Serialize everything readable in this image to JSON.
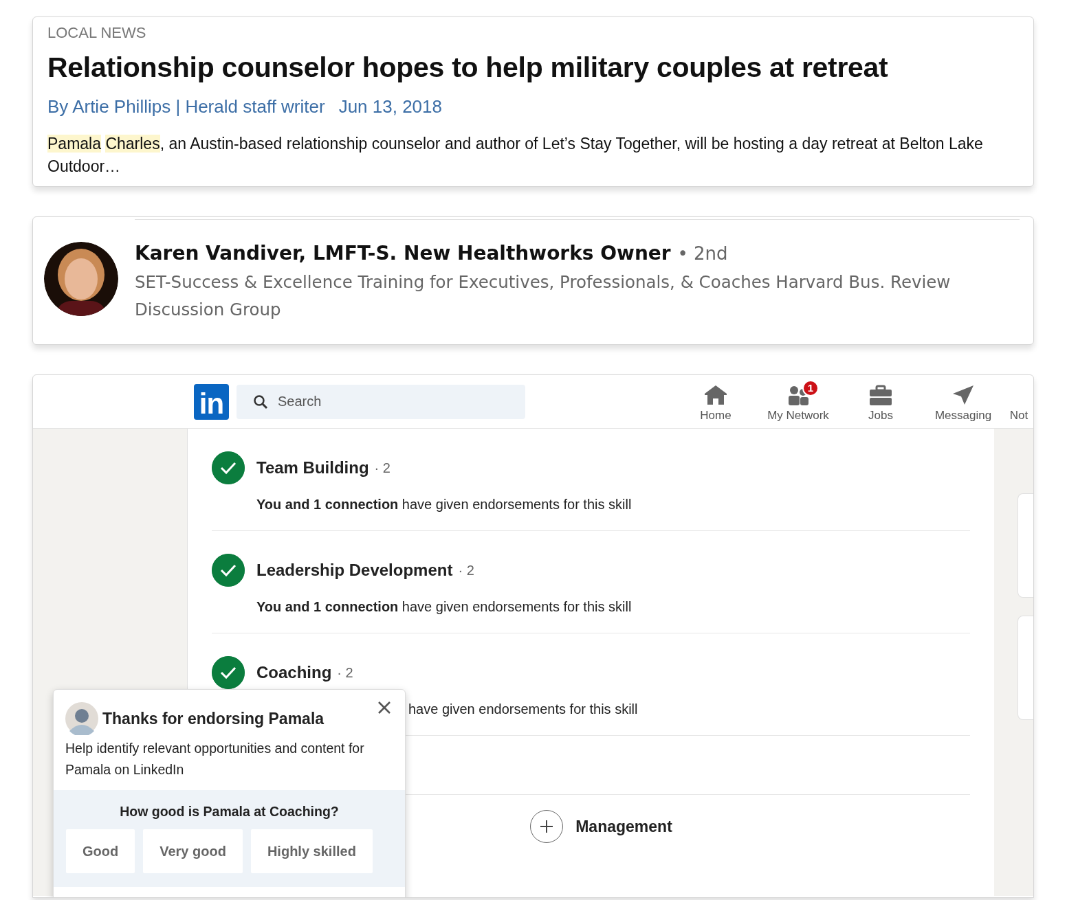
{
  "article": {
    "section": "LOCAL NEWS",
    "headline": "Relationship counselor hopes to help military couples at retreat",
    "byline": "By Artie Phillips | Herald staff writer",
    "date": "Jun 13, 2018",
    "excerpt": [
      {
        "text": "Pamala",
        "highlighted": true
      },
      {
        "text": "Charles",
        "highlighted": true
      },
      {
        "text": ", an Austin-based relationship counselor and author of Let’s Stay Together, will be hosting a day retreat at Belton Lake Outdoor…",
        "highlighted": false
      }
    ]
  },
  "profile": {
    "name": "Karen Vandiver, LMFT-S. New Healthworks Owner",
    "degree": "• 2nd",
    "headline": "SET-Success & Excellence Training for Executives, Professionals, & Coaches Harvard Bus. Review Discussion Group"
  },
  "linkedin": {
    "logo": "in",
    "search": {
      "placeholder": "Search"
    },
    "nav": [
      {
        "label": "Home"
      },
      {
        "label": "My Network",
        "badge": "1"
      },
      {
        "label": "Jobs"
      },
      {
        "label": "Messaging"
      },
      {
        "label": "Not"
      }
    ],
    "skills": [
      {
        "name": "Team Building",
        "count": "· 2",
        "endorsed": true,
        "kind": "full",
        "endorsement": "**You and 1 connection** have given endorsements for this skill"
      },
      {
        "name": "Leadership Development",
        "count": "· 2",
        "endorsed": true,
        "kind": "full",
        "endorsement": "**You and 1 connection** have given endorsements for this skill"
      },
      {
        "name": "Coaching",
        "count": "· 2",
        "endorsed": true,
        "kind": "covered",
        "endorsement": "have given endorsements for this skill"
      },
      {
        "name": "Management",
        "kind": "add"
      }
    ],
    "popup": {
      "title": "Thanks for endorsing Pamala",
      "message": "Help identify relevant opportunities and content for Pamala on LinkedIn",
      "question": "How good is Pamala at Coaching?",
      "options": [
        "Good",
        "Very good",
        "Highly skilled"
      ]
    }
  }
}
